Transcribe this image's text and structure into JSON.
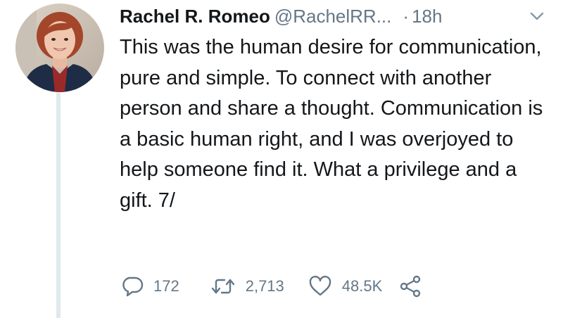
{
  "tweet": {
    "author_name": "Rachel R. Romeo",
    "handle": "@RachelRR...",
    "separator": "·",
    "time": "18h",
    "text": "This was the human desire for communication, pure and simple. To connect with another person and share a thought. Communication is a basic human right, and I was overjoyed to help someone find it. What a privilege and a gift. 7/",
    "replies": "172",
    "retweets": "2,713",
    "likes": "48.5K"
  },
  "icons": {
    "reply": "reply-bubble-icon",
    "retweet": "retweet-icon",
    "like": "heart-icon",
    "share": "share-icon",
    "menu": "chevron-down-icon"
  },
  "colors": {
    "text": "#14171a",
    "secondary": "#657786",
    "thread_line": "#e1e8ed"
  }
}
